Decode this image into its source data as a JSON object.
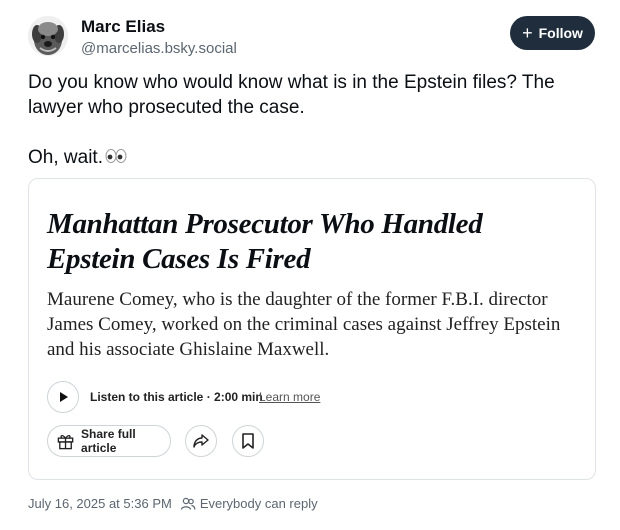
{
  "author": {
    "name": "Marc Elias",
    "handle": "@marcelias.bsky.social",
    "avatar_icon": "dog-avatar-icon"
  },
  "follow": {
    "icon": "plus-icon",
    "label": "Follow"
  },
  "post": {
    "line1": "Do you know who would know what is in the Epstein files? The lawyer who prosecuted the case.",
    "line2": "Oh, wait.",
    "emoji": "eyes-emoji-icon"
  },
  "card": {
    "headline": "Manhattan Prosecutor Who Handled Epstein Cases Is Fired",
    "dek": "Maurene Comey, who is the daughter of the former F.B.I. director James Comey, worked on the criminal cases against Jeffrey Epstein and his associate Ghislaine Maxwell.",
    "listen_label": "Listen to this article · 2:00 min",
    "learn_more": "Learn more",
    "share_label": "Share full article"
  },
  "footer": {
    "timestamp": "July 16, 2025 at 5:36 PM",
    "reply_setting": "Everybody can reply"
  },
  "colors": {
    "follow_bg": "#1f2d3d",
    "muted_text": "#5b6670",
    "border": "#dfe3e7"
  }
}
